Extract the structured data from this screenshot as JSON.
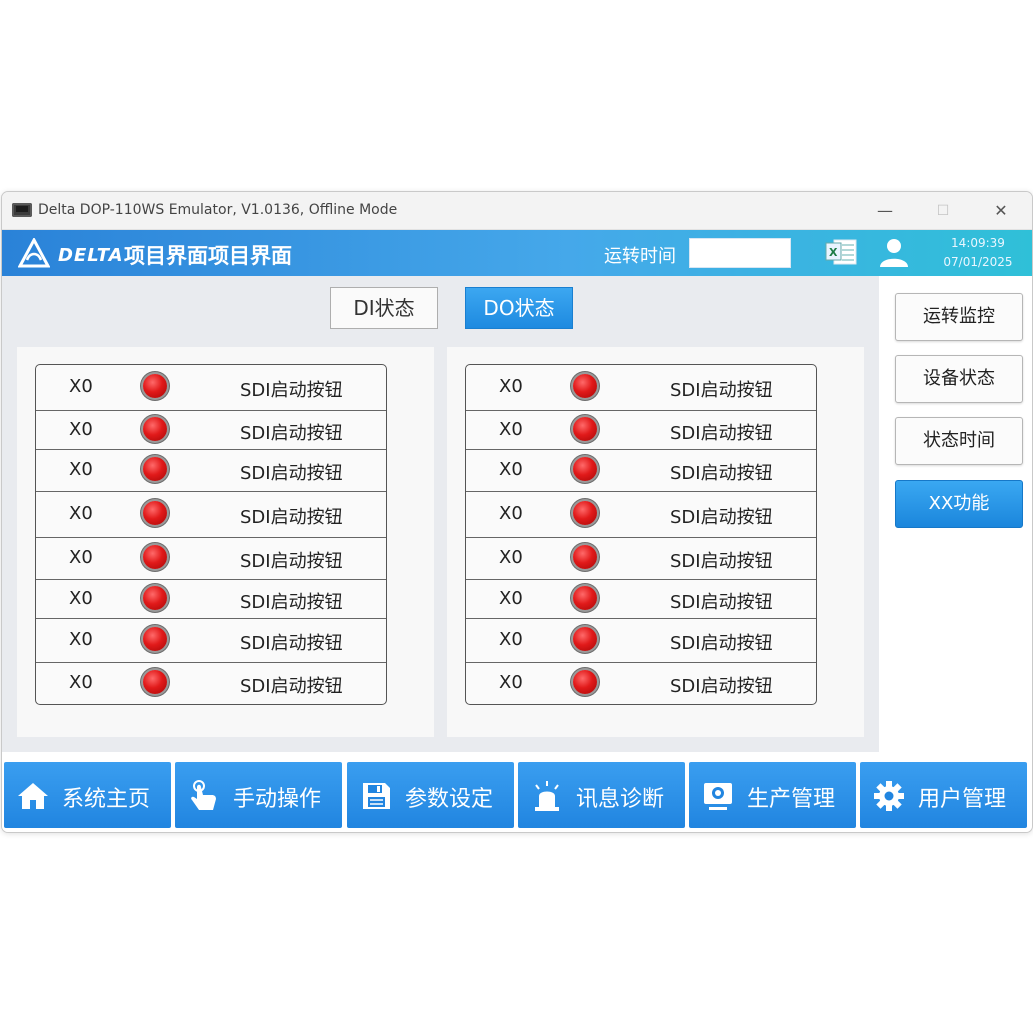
{
  "window": {
    "title": "Delta DOP-110WS Emulator, V1.0136, Offline Mode",
    "minimize": "—",
    "maximize": "☐",
    "close": "✕"
  },
  "header": {
    "logo_text": "DELTA",
    "project_title": "项目界面项目界面",
    "runtime_label": "运转时间",
    "runtime_value": "",
    "time": "14:09:39",
    "date": "07/01/2025"
  },
  "tabs": {
    "di": "DI状态",
    "do": "DO状态"
  },
  "di_table": [
    {
      "addr": "X0",
      "name": "SDI启动按钮",
      "state": "on"
    },
    {
      "addr": "X0",
      "name": "SDI启动按钮",
      "state": "on"
    },
    {
      "addr": "X0",
      "name": "SDI启动按钮",
      "state": "on"
    },
    {
      "addr": "X0",
      "name": "SDI启动按钮",
      "state": "on"
    },
    {
      "addr": "X0",
      "name": "SDI启动按钮",
      "state": "on"
    },
    {
      "addr": "X0",
      "name": "SDI启动按钮",
      "state": "on"
    },
    {
      "addr": "X0",
      "name": "SDI启动按钮",
      "state": "on"
    },
    {
      "addr": "X0",
      "name": "SDI启动按钮",
      "state": "on"
    }
  ],
  "do_table": [
    {
      "addr": "X0",
      "name": "SDI启动按钮",
      "state": "on"
    },
    {
      "addr": "X0",
      "name": "SDI启动按钮",
      "state": "on"
    },
    {
      "addr": "X0",
      "name": "SDI启动按钮",
      "state": "on"
    },
    {
      "addr": "X0",
      "name": "SDI启动按钮",
      "state": "on"
    },
    {
      "addr": "X0",
      "name": "SDI启动按钮",
      "state": "on"
    },
    {
      "addr": "X0",
      "name": "SDI启动按钮",
      "state": "on"
    },
    {
      "addr": "X0",
      "name": "SDI启动按钮",
      "state": "on"
    },
    {
      "addr": "X0",
      "name": "SDI启动按钮",
      "state": "on"
    }
  ],
  "side_menu": [
    "运转监控",
    "设备状态",
    "状态时间",
    "XX功能"
  ],
  "nav": [
    {
      "label": "系统主页",
      "icon": "home-icon"
    },
    {
      "label": "手动操作",
      "icon": "hand-pointer-icon"
    },
    {
      "label": "参数设定",
      "icon": "save-icon"
    },
    {
      "label": "讯息诊断",
      "icon": "alarm-light-icon"
    },
    {
      "label": "生产管理",
      "icon": "monitor-icon"
    },
    {
      "label": "用户管理",
      "icon": "gear-icon"
    }
  ],
  "colors": {
    "accent": "#2185e0",
    "header_start": "#2a82d8",
    "header_end": "#2fc0d8",
    "led_on": "#e11a1a"
  }
}
